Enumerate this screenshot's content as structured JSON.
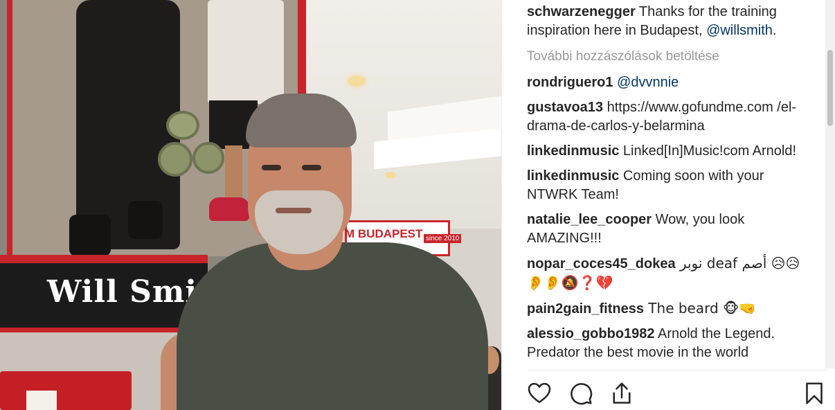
{
  "post": {
    "caption": {
      "username": "schwarzenegger",
      "text_before": " Thanks for the training inspiration here in Budapest, ",
      "mention": "@willsmith",
      "text_after": "."
    },
    "load_more_label": "További hozzászólások betöltése",
    "comments": [
      {
        "username": "rondriguero1",
        "text": "",
        "mention": "@dvvnnie"
      },
      {
        "username": "gustavoa13",
        "text": " https://www.gofundme.com /el-drama-de-carlos-y-belarmina"
      },
      {
        "username": "linkedinmusic",
        "text": " Linked[In]Music!com Arnold!"
      },
      {
        "username": "linkedinmusic",
        "text": " Coming soon with your NTWRK Team!"
      },
      {
        "username": "natalie_lee_cooper",
        "text": " Wow, you look AMAZING!!!"
      },
      {
        "username": "nopar_coces45_dokea",
        "text": " نوبر deaf أصم 😥😥 👂👂🔕❓💔"
      },
      {
        "username": "pain2gain_fitness",
        "text": " The beard 🐵🤜"
      },
      {
        "username": "alessio_gobbo1982",
        "text": " Arnold the Legend. Predator the best movie in the world"
      }
    ]
  },
  "photo": {
    "sign_text": "Will Smi",
    "budapest_text": "M BUDAPEST",
    "since_text": "since 2010"
  },
  "actions": {
    "like_icon": "heart-icon",
    "comment_icon": "comment-icon",
    "share_icon": "share-icon",
    "save_icon": "bookmark-icon"
  }
}
